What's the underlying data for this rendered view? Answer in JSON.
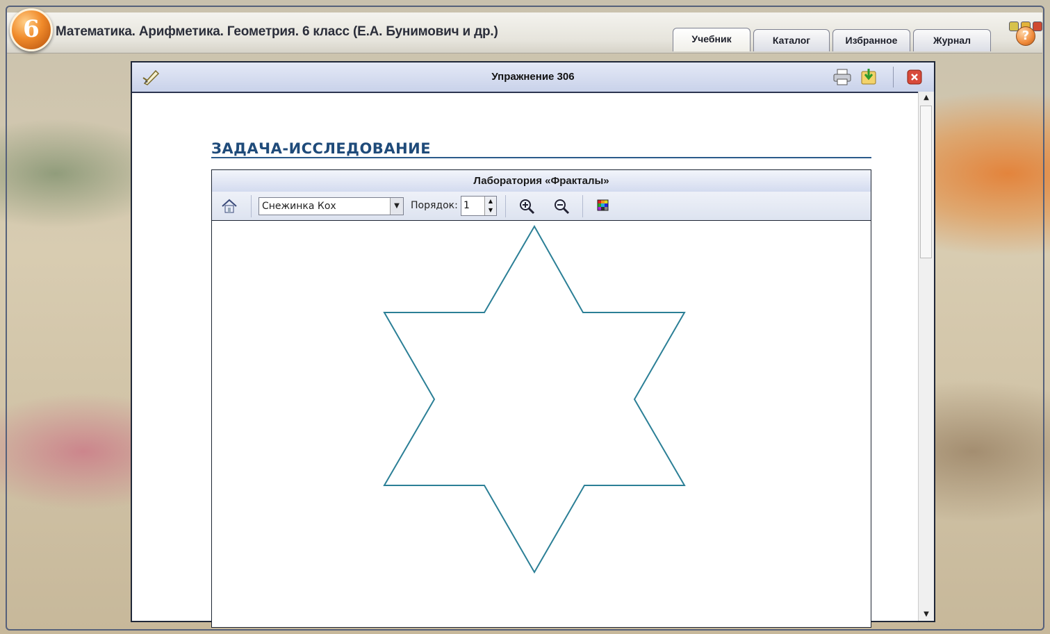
{
  "app": {
    "grade": "6",
    "title": "Математика. Арифметика. Геометрия. 6 класс (Е.А. Бунимович и др.)"
  },
  "tabs": [
    {
      "label": "Учебник",
      "active": true
    },
    {
      "label": "Каталог",
      "active": false
    },
    {
      "label": "Избранное",
      "active": false
    },
    {
      "label": "Журнал",
      "active": false
    }
  ],
  "help": {
    "label": "?"
  },
  "content": {
    "exercise_title": "Упражнение 306",
    "section_heading": "ЗАДАЧА-ИССЛЕДОВАНИЕ"
  },
  "lab": {
    "title": "Лаборатория «Фракталы»",
    "fractal_selected": "Снежинка Кох",
    "order_label": "Порядок:",
    "order_value": "1"
  },
  "colors": {
    "accent_heading": "#1f4b7a",
    "fractal_stroke": "#2b7f96"
  },
  "icons": [
    "pen-icon",
    "print-icon",
    "save-icon",
    "close-icon",
    "home-icon",
    "zoom-in-icon",
    "zoom-out-icon",
    "palette-icon"
  ]
}
